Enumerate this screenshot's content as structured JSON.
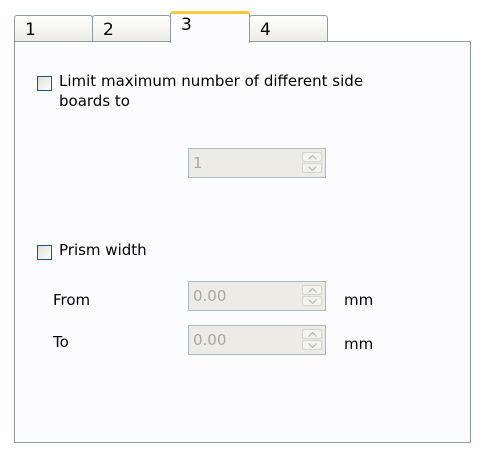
{
  "tabs": [
    {
      "label": "1"
    },
    {
      "label": "2"
    },
    {
      "label": "3"
    },
    {
      "label": "4"
    }
  ],
  "active_tab": "3",
  "limit_side_boards": {
    "checked": false,
    "label_line1": "Limit maximum number of different side",
    "label_line2": "boards to",
    "value": "1"
  },
  "prism_width": {
    "checked": false,
    "label": "Prism width",
    "from_label": "From",
    "from_value": "0.00",
    "to_label": "To",
    "to_value": "0.00",
    "unit": "mm"
  },
  "colors": {
    "accent_tab": "#ffc83c",
    "border": "#919b9c",
    "checkbox_border": "#1c5180",
    "disabled_text": "#a8a89e"
  },
  "icons": [
    "chevron-up-icon",
    "chevron-down-icon"
  ]
}
